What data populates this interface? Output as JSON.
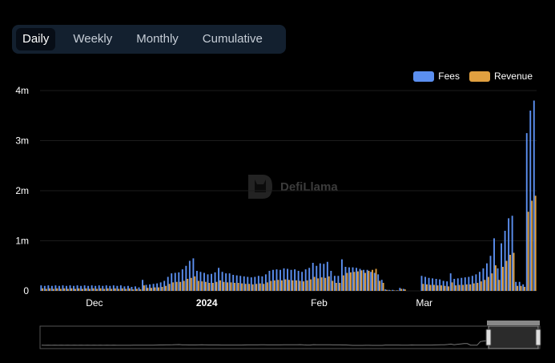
{
  "tabs": [
    {
      "label": "Daily",
      "active": true
    },
    {
      "label": "Weekly",
      "active": false
    },
    {
      "label": "Monthly",
      "active": false
    },
    {
      "label": "Cumulative",
      "active": false
    }
  ],
  "watermark": "DefiLlama",
  "colors": {
    "fees": "#5b8ff0",
    "revenue": "#e0a040",
    "background": "#000000"
  },
  "chart_data": {
    "type": "bar",
    "legend_position": "top-right",
    "grid": true,
    "ylim": [
      0,
      4000000
    ],
    "yticks": [
      {
        "v": 0,
        "label": "0"
      },
      {
        "v": 1000000,
        "label": "1m"
      },
      {
        "v": 2000000,
        "label": "2m"
      },
      {
        "v": 3000000,
        "label": "3m"
      },
      {
        "v": 4000000,
        "label": "4m"
      }
    ],
    "xticks": [
      {
        "i": 15,
        "label": "Dec",
        "bold": false
      },
      {
        "i": 46,
        "label": "2024",
        "bold": true
      },
      {
        "i": 77,
        "label": "Feb",
        "bold": false
      },
      {
        "i": 106,
        "label": "Mar",
        "bold": false
      }
    ],
    "series": [
      {
        "name": "Fees",
        "color": "#5b8ff0",
        "values": [
          110000,
          100000,
          110000,
          100000,
          110000,
          100000,
          110000,
          100000,
          110000,
          100000,
          110000,
          100000,
          110000,
          100000,
          110000,
          100000,
          110000,
          100000,
          110000,
          100000,
          110000,
          100000,
          110000,
          90000,
          100000,
          80000,
          90000,
          70000,
          220000,
          120000,
          130000,
          140000,
          150000,
          170000,
          200000,
          280000,
          350000,
          360000,
          370000,
          430000,
          500000,
          600000,
          650000,
          400000,
          380000,
          360000,
          330000,
          340000,
          370000,
          460000,
          380000,
          350000,
          350000,
          320000,
          310000,
          300000,
          290000,
          280000,
          270000,
          280000,
          300000,
          290000,
          330000,
          400000,
          420000,
          430000,
          420000,
          450000,
          440000,
          420000,
          430000,
          400000,
          380000,
          430000,
          460000,
          560000,
          500000,
          550000,
          540000,
          580000,
          400000,
          300000,
          300000,
          630000,
          480000,
          470000,
          470000,
          460000,
          440000,
          420000,
          420000,
          380000,
          360000,
          330000,
          220000,
          30000,
          20000,
          20000,
          10000,
          60000,
          40000,
          0,
          0,
          0,
          0,
          300000,
          280000,
          260000,
          250000,
          240000,
          230000,
          200000,
          190000,
          350000,
          240000,
          250000,
          260000,
          270000,
          280000,
          300000,
          330000,
          380000,
          450000,
          550000,
          700000,
          1050000,
          450000,
          950000,
          1200000,
          1450000,
          1500000,
          180000,
          180000,
          130000,
          3150000,
          3600000,
          3800000
        ],
        "shows_in_detail": true
      },
      {
        "name": "Revenue",
        "color": "#e0a040",
        "values": [
          50000,
          40000,
          50000,
          40000,
          50000,
          40000,
          50000,
          40000,
          50000,
          40000,
          50000,
          40000,
          50000,
          40000,
          50000,
          40000,
          50000,
          40000,
          50000,
          40000,
          50000,
          40000,
          50000,
          40000,
          50000,
          30000,
          40000,
          30000,
          110000,
          60000,
          60000,
          70000,
          70000,
          80000,
          100000,
          140000,
          170000,
          180000,
          180000,
          200000,
          240000,
          260000,
          290000,
          200000,
          190000,
          180000,
          160000,
          160000,
          180000,
          210000,
          180000,
          170000,
          170000,
          160000,
          160000,
          150000,
          140000,
          140000,
          130000,
          140000,
          150000,
          140000,
          170000,
          200000,
          210000,
          220000,
          210000,
          230000,
          220000,
          210000,
          210000,
          200000,
          190000,
          210000,
          230000,
          280000,
          250000,
          270000,
          260000,
          290000,
          200000,
          160000,
          160000,
          310000,
          360000,
          370000,
          380000,
          390000,
          410000,
          360000,
          400000,
          420000,
          440000,
          200000,
          160000,
          20000,
          10000,
          10000,
          10000,
          40000,
          30000,
          0,
          0,
          0,
          0,
          140000,
          130000,
          120000,
          120000,
          110000,
          110000,
          100000,
          90000,
          170000,
          110000,
          120000,
          120000,
          130000,
          130000,
          150000,
          160000,
          190000,
          220000,
          280000,
          350000,
          510000,
          220000,
          480000,
          600000,
          720000,
          760000,
          100000,
          100000,
          80000,
          1580000,
          1800000,
          1900000
        ]
      }
    ]
  }
}
